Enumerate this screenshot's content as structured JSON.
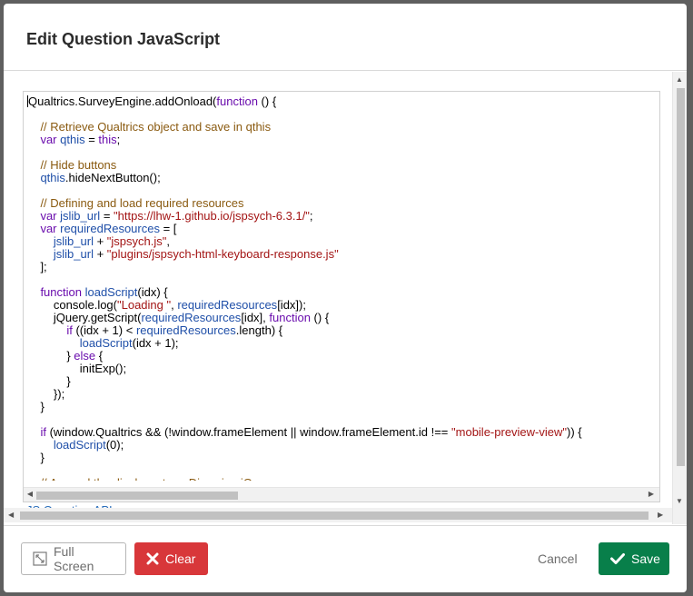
{
  "dialog": {
    "title": "Edit Question JavaScript"
  },
  "editor": {
    "lines": [
      [
        {
          "t": "Qualtrics.SurveyEngine.addOnload(",
          "c": ""
        },
        {
          "t": "function",
          "c": "k"
        },
        {
          "t": " () {",
          "c": ""
        }
      ],
      [],
      [
        {
          "t": "    // Retrieve Qualtrics object and save in qthis",
          "c": "c"
        }
      ],
      [
        {
          "t": "    var ",
          "c": "k"
        },
        {
          "t": "qthis",
          "c": "v"
        },
        {
          "t": " = ",
          "c": ""
        },
        {
          "t": "this",
          "c": "k"
        },
        {
          "t": ";",
          "c": ""
        }
      ],
      [],
      [
        {
          "t": "    // Hide buttons",
          "c": "c"
        }
      ],
      [
        {
          "t": "    qthis",
          "c": "v"
        },
        {
          "t": ".hideNextButton();",
          "c": ""
        }
      ],
      [],
      [
        {
          "t": "    // Defining and load required resources",
          "c": "c"
        }
      ],
      [
        {
          "t": "    var ",
          "c": "k"
        },
        {
          "t": "jslib_url",
          "c": "v"
        },
        {
          "t": " = ",
          "c": ""
        },
        {
          "t": "\"https://lhw-1.github.io/jspsych-6.3.1/\"",
          "c": "s"
        },
        {
          "t": ";",
          "c": ""
        }
      ],
      [
        {
          "t": "    var ",
          "c": "k"
        },
        {
          "t": "requiredResources",
          "c": "v"
        },
        {
          "t": " = [",
          "c": ""
        }
      ],
      [
        {
          "t": "        jslib_url",
          "c": "v"
        },
        {
          "t": " + ",
          "c": ""
        },
        {
          "t": "\"jspsych.js\"",
          "c": "s"
        },
        {
          "t": ",",
          "c": ""
        }
      ],
      [
        {
          "t": "        jslib_url",
          "c": "v"
        },
        {
          "t": " + ",
          "c": ""
        },
        {
          "t": "\"plugins/jspsych-html-keyboard-response.js\"",
          "c": "s"
        }
      ],
      [
        {
          "t": "    ];",
          "c": ""
        }
      ],
      [],
      [
        {
          "t": "    function ",
          "c": "k"
        },
        {
          "t": "loadScript",
          "c": "v"
        },
        {
          "t": "(idx) {",
          "c": ""
        }
      ],
      [
        {
          "t": "        console.log(",
          "c": ""
        },
        {
          "t": "\"Loading \"",
          "c": "s"
        },
        {
          "t": ", ",
          "c": ""
        },
        {
          "t": "requiredResources",
          "c": "v"
        },
        {
          "t": "[idx]);",
          "c": ""
        }
      ],
      [
        {
          "t": "        jQuery.getScript(",
          "c": ""
        },
        {
          "t": "requiredResources",
          "c": "v"
        },
        {
          "t": "[idx], ",
          "c": ""
        },
        {
          "t": "function",
          "c": "k"
        },
        {
          "t": " () {",
          "c": ""
        }
      ],
      [
        {
          "t": "            if ",
          "c": "k"
        },
        {
          "t": "((idx + 1) < ",
          "c": ""
        },
        {
          "t": "requiredResources",
          "c": "v"
        },
        {
          "t": ".length) {",
          "c": ""
        }
      ],
      [
        {
          "t": "                loadScript",
          "c": "v"
        },
        {
          "t": "(idx + 1);",
          "c": ""
        }
      ],
      [
        {
          "t": "            } ",
          "c": ""
        },
        {
          "t": "else",
          "c": "k"
        },
        {
          "t": " {",
          "c": ""
        }
      ],
      [
        {
          "t": "                initExp();",
          "c": ""
        }
      ],
      [
        {
          "t": "            }",
          "c": ""
        }
      ],
      [
        {
          "t": "        });",
          "c": ""
        }
      ],
      [
        {
          "t": "    }",
          "c": ""
        }
      ],
      [],
      [
        {
          "t": "    if ",
          "c": "k"
        },
        {
          "t": "(window.Qualtrics && (!window.frameElement || window.frameElement.id !== ",
          "c": ""
        },
        {
          "t": "\"mobile-preview-view\"",
          "c": "s"
        },
        {
          "t": ")) {",
          "c": ""
        }
      ],
      [
        {
          "t": "        loadScript",
          "c": "v"
        },
        {
          "t": "(0);",
          "c": ""
        }
      ],
      [
        {
          "t": "    }",
          "c": ""
        }
      ],
      [],
      [
        {
          "t": "    // Append the display_stage Div using jQuery",
          "c": "c"
        }
      ]
    ]
  },
  "links": {
    "api_label": "JS Question API"
  },
  "footer": {
    "fullscreen_label": "Full Screen",
    "clear_label": "Clear",
    "cancel_label": "Cancel",
    "save_label": "Save"
  },
  "colors": {
    "clear": "#d8373a",
    "save": "#087f4a",
    "link": "#2a6ebb"
  },
  "icons": {
    "fullscreen": "expand-icon",
    "clear": "x-icon",
    "save": "check-icon"
  }
}
